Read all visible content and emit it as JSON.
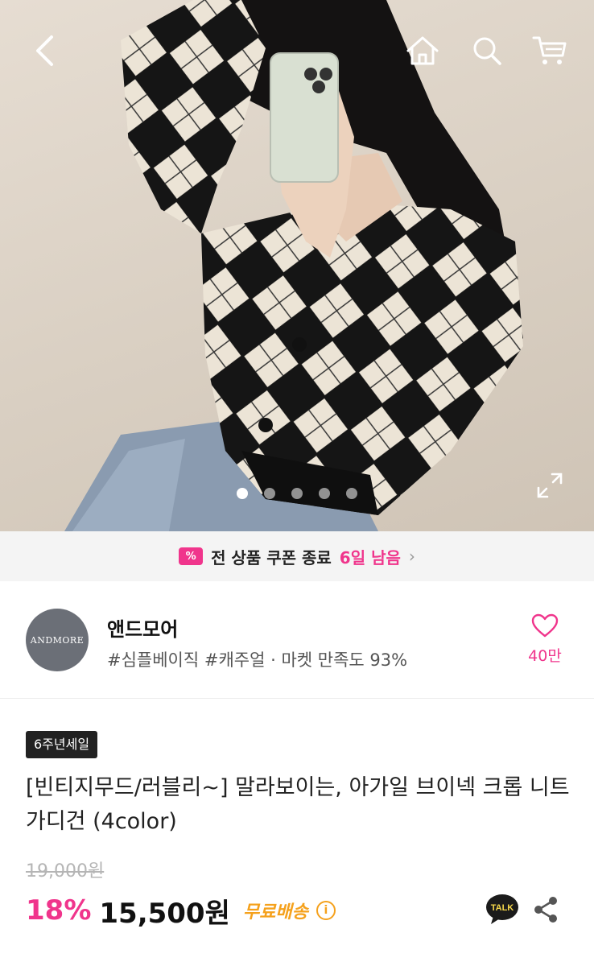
{
  "hero": {
    "icons": {
      "back": "chevron-left-icon",
      "home": "home-icon",
      "search": "search-icon",
      "cart": "cart-icon",
      "expand": "expand-icon"
    },
    "carousel": {
      "total": 5,
      "active": 1
    }
  },
  "coupon": {
    "text": "전 상품 쿠폰 종료",
    "days": "6일 남음",
    "ticket_symbol": "%"
  },
  "store": {
    "logo_text": "ANDMORE",
    "name": "앤드모어",
    "tags": "#심플베이직 #캐주얼 · 마켓 만족도 93%",
    "likes": "40만"
  },
  "product": {
    "badge": "6주년세일",
    "title": "[빈티지무드/러블리~] 말라보이는, 아가일 브이넥 크롭 니트가디건 (4color)",
    "original_price": "19,000원",
    "discount": "18%",
    "price": "15,500원",
    "shipping": "무료배송",
    "talk_label": "TALK"
  },
  "colors": {
    "accent": "#f0358c",
    "shipping": "#f5a11c"
  }
}
